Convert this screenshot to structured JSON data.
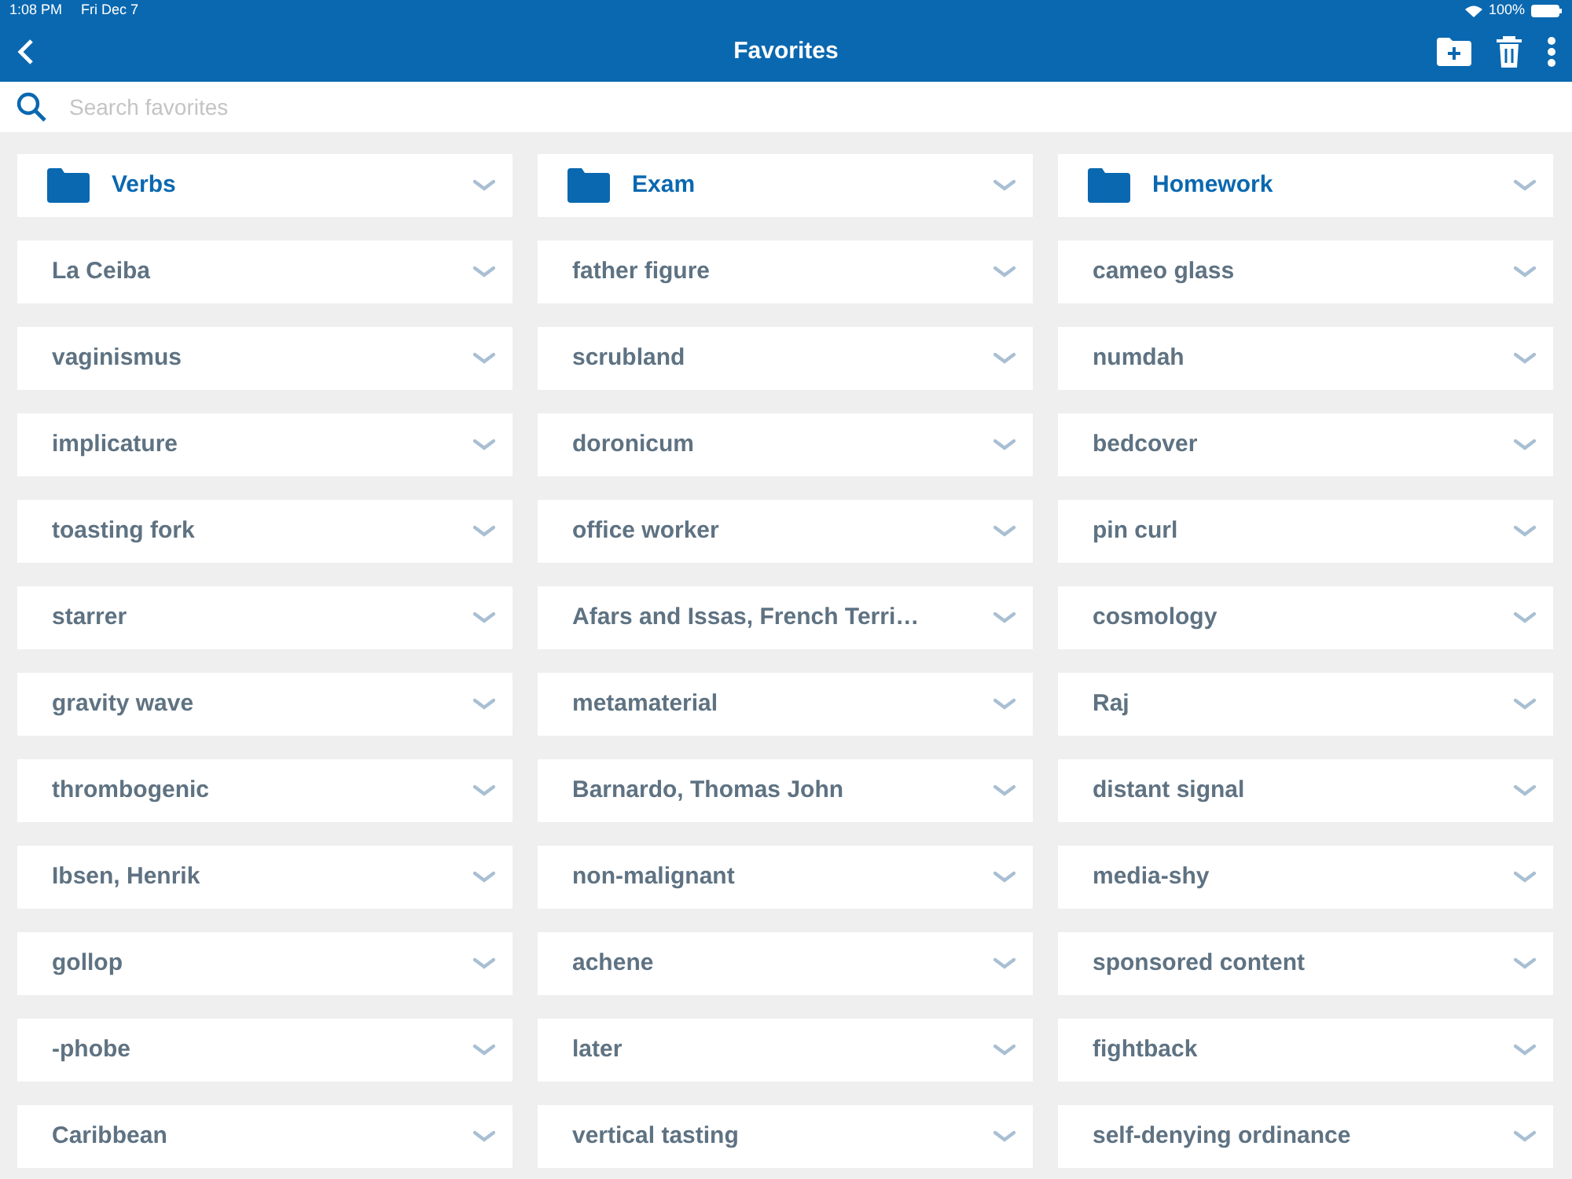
{
  "status_bar": {
    "time": "1:08 PM",
    "date": "Fri Dec 7",
    "battery": "100%"
  },
  "header": {
    "title": "Favorites"
  },
  "search": {
    "placeholder": "Search favorites"
  },
  "columns": [
    {
      "folder": "Verbs",
      "items": [
        "La Ceiba",
        "vaginismus",
        "implicature",
        "toasting fork",
        "starrer",
        "gravity wave",
        "thrombogenic",
        "Ibsen, Henrik",
        "gollop",
        "-phobe",
        "Caribbean"
      ]
    },
    {
      "folder": "Exam",
      "items": [
        "father figure",
        "scrubland",
        "doronicum",
        "office worker",
        "Afars and Issas, French Terri…",
        "metamaterial",
        "Barnardo, Thomas John",
        "non-malignant",
        "achene",
        "later",
        "vertical tasting"
      ]
    },
    {
      "folder": "Homework",
      "items": [
        "cameo glass",
        "numdah",
        "bedcover",
        "pin curl",
        "cosmology",
        "Raj",
        "distant signal",
        "media-shy",
        "sponsored content",
        "fightback",
        "self-denying ordinance"
      ]
    }
  ]
}
